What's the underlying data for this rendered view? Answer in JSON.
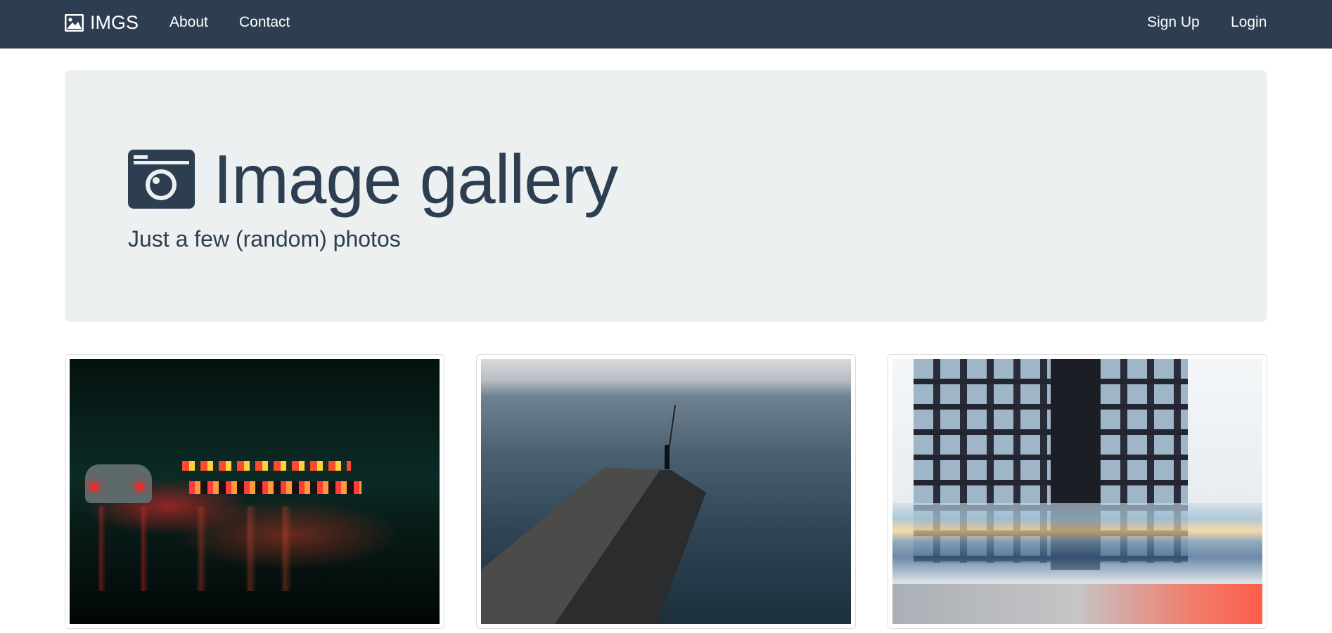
{
  "navbar": {
    "brand": "IMGS",
    "brand_icon": "image-icon",
    "links": {
      "about": "About",
      "contact": "Contact",
      "signup": "Sign Up",
      "login": "Login"
    },
    "background_color": "#2c3e50"
  },
  "jumbotron": {
    "icon": "camera-icon",
    "title": "Image gallery",
    "subtitle": "Just a few (random) photos",
    "background_color": "#ecf0f1"
  },
  "gallery": {
    "photos": [
      {
        "subject": "night street with red lights"
      },
      {
        "subject": "fisherman on pier by the sea"
      },
      {
        "subject": "modern building with tram motion blur"
      }
    ]
  }
}
